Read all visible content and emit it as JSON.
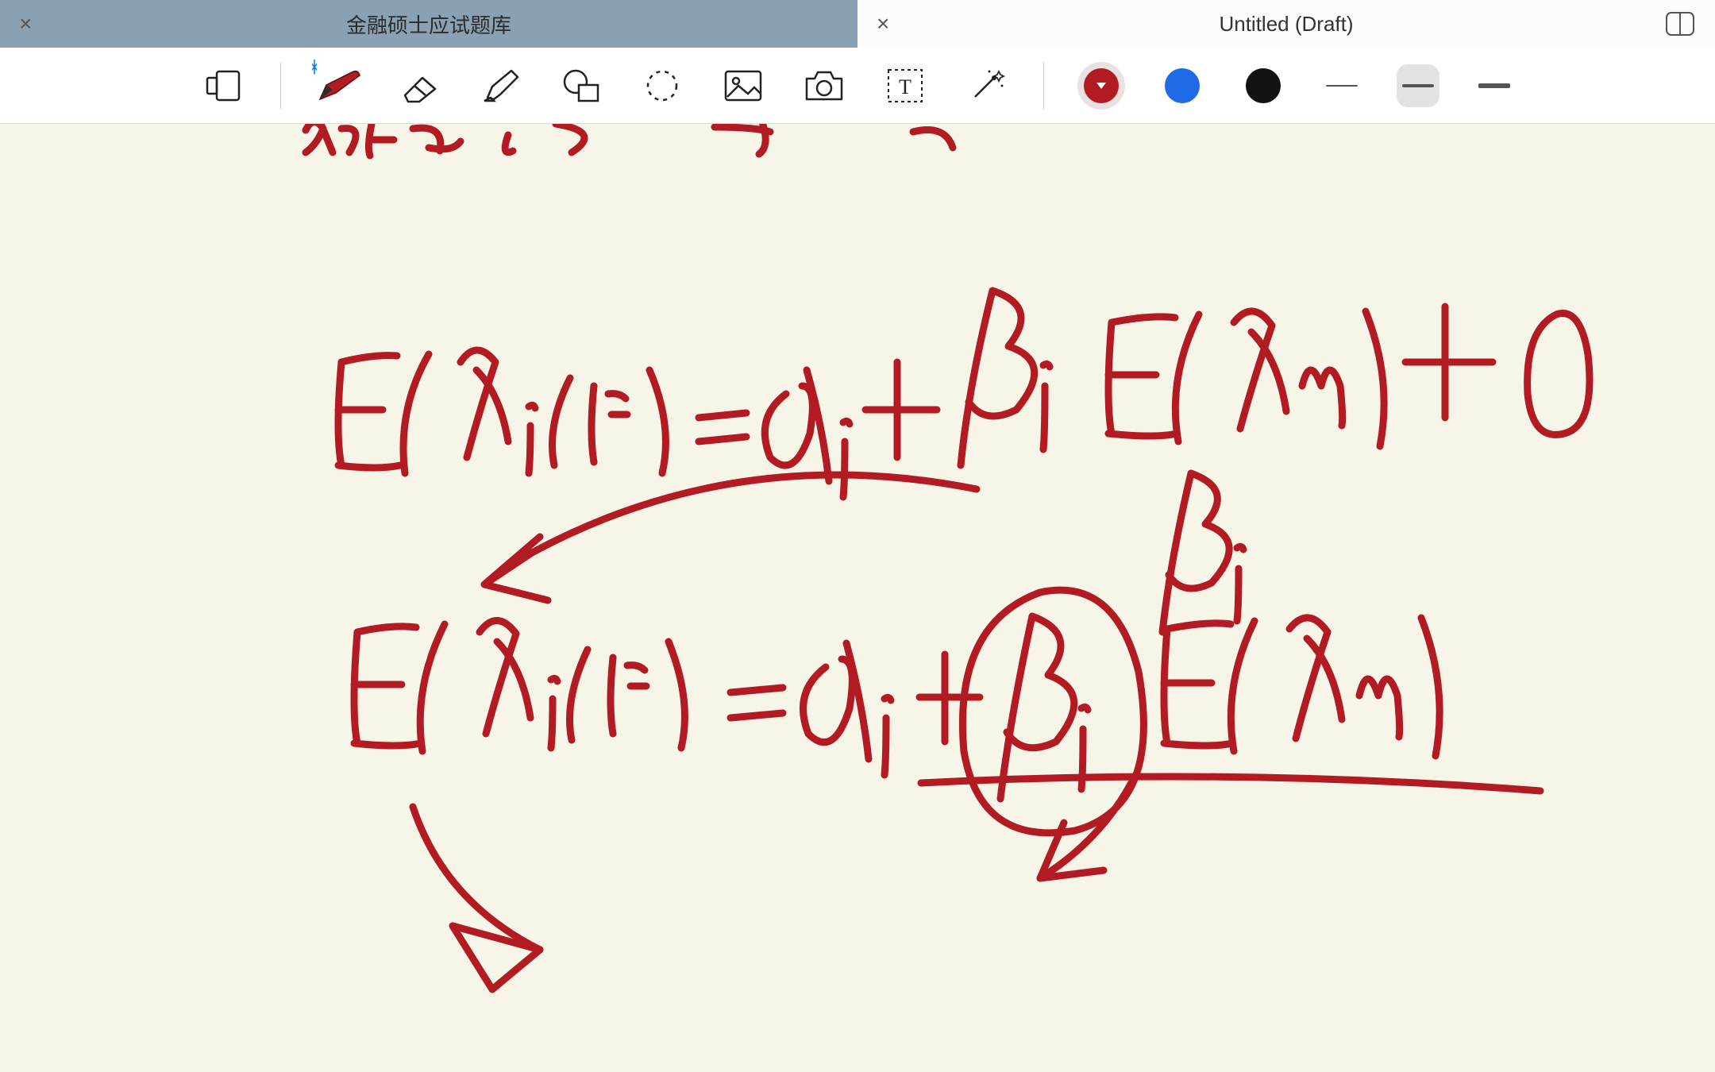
{
  "tabs": {
    "inactive": {
      "title": "金融硕士应试题库",
      "close": "×"
    },
    "active": {
      "title": "Untitled (Draft)",
      "close": "×"
    }
  },
  "toolbar": {
    "icons": {
      "page": "page-icon",
      "pen": "pen-icon",
      "eraser": "eraser-icon",
      "highlighter": "highlighter-icon",
      "shapes": "shapes-icon",
      "lasso": "lasso-icon",
      "image": "image-icon",
      "camera": "camera-icon",
      "text": "text-icon",
      "wand": "wand-icon"
    },
    "colors": {
      "red": "#b31b22",
      "blue": "#1E6BE5",
      "black": "#121212",
      "selected": "red"
    },
    "strokes": {
      "options": [
        "thin",
        "medium",
        "thick"
      ],
      "selected": "medium"
    },
    "bluetooth_badge": "ᚼ"
  },
  "handwriting": {
    "ink_color": "#b31b22",
    "content_description": "Handwritten finance equations in red ink: E(Ri(t)) = αi + βi E(Rm) + 0, repeated below with βi circled, arrows connecting terms, and partial Chinese characters cut off at top."
  }
}
